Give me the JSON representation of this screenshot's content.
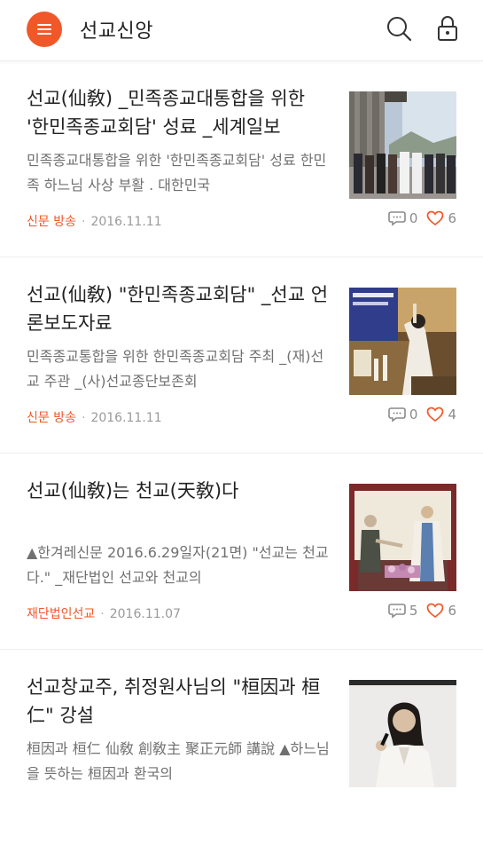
{
  "header": {
    "title": "선교신앙",
    "menu_icon": "hamburger-icon",
    "search_icon": "search-icon",
    "lock_icon": "lock-icon",
    "accent": "#f0582a"
  },
  "posts": [
    {
      "title": "선교(仙敎) _민족종교대통합을 위한 '한민족종교회담' 성료 _세계일보",
      "summary": "민족종교대통합을 위한 '한민족종교회담' 성료 한민족 하느님 사상 부활 . 대한민국",
      "category": "신문 방송",
      "date": "2016.11.11",
      "comments": "0",
      "likes": "6"
    },
    {
      "title": "선교(仙敎) \"한민족종교회담\" _선교 언론보도자료",
      "summary": "민족종교통합을 위한 한민족종교회담 주최 _(재)선교 주관 _(사)선교종단보존회",
      "category": "신문 방송",
      "date": "2016.11.11",
      "comments": "0",
      "likes": "4"
    },
    {
      "title": "선교(仙敎)는 천교(天敎)다",
      "summary": "▲한겨레신문 2016.6.29일자(21면) \"선교는 천교다.\" _재단법인 선교와 천교의",
      "category": "재단법인선교",
      "date": "2016.11.07",
      "comments": "5",
      "likes": "6"
    },
    {
      "title": "선교창교주, 취정원사님의 \"桓因과 桓仁\" 강설",
      "summary": "桓因과 桓仁 仙敎 創敎主 聚正元師 講說 ▲하느님을 뜻하는 桓因과 환국의",
      "category": "",
      "date": "",
      "comments": "",
      "likes": ""
    }
  ]
}
